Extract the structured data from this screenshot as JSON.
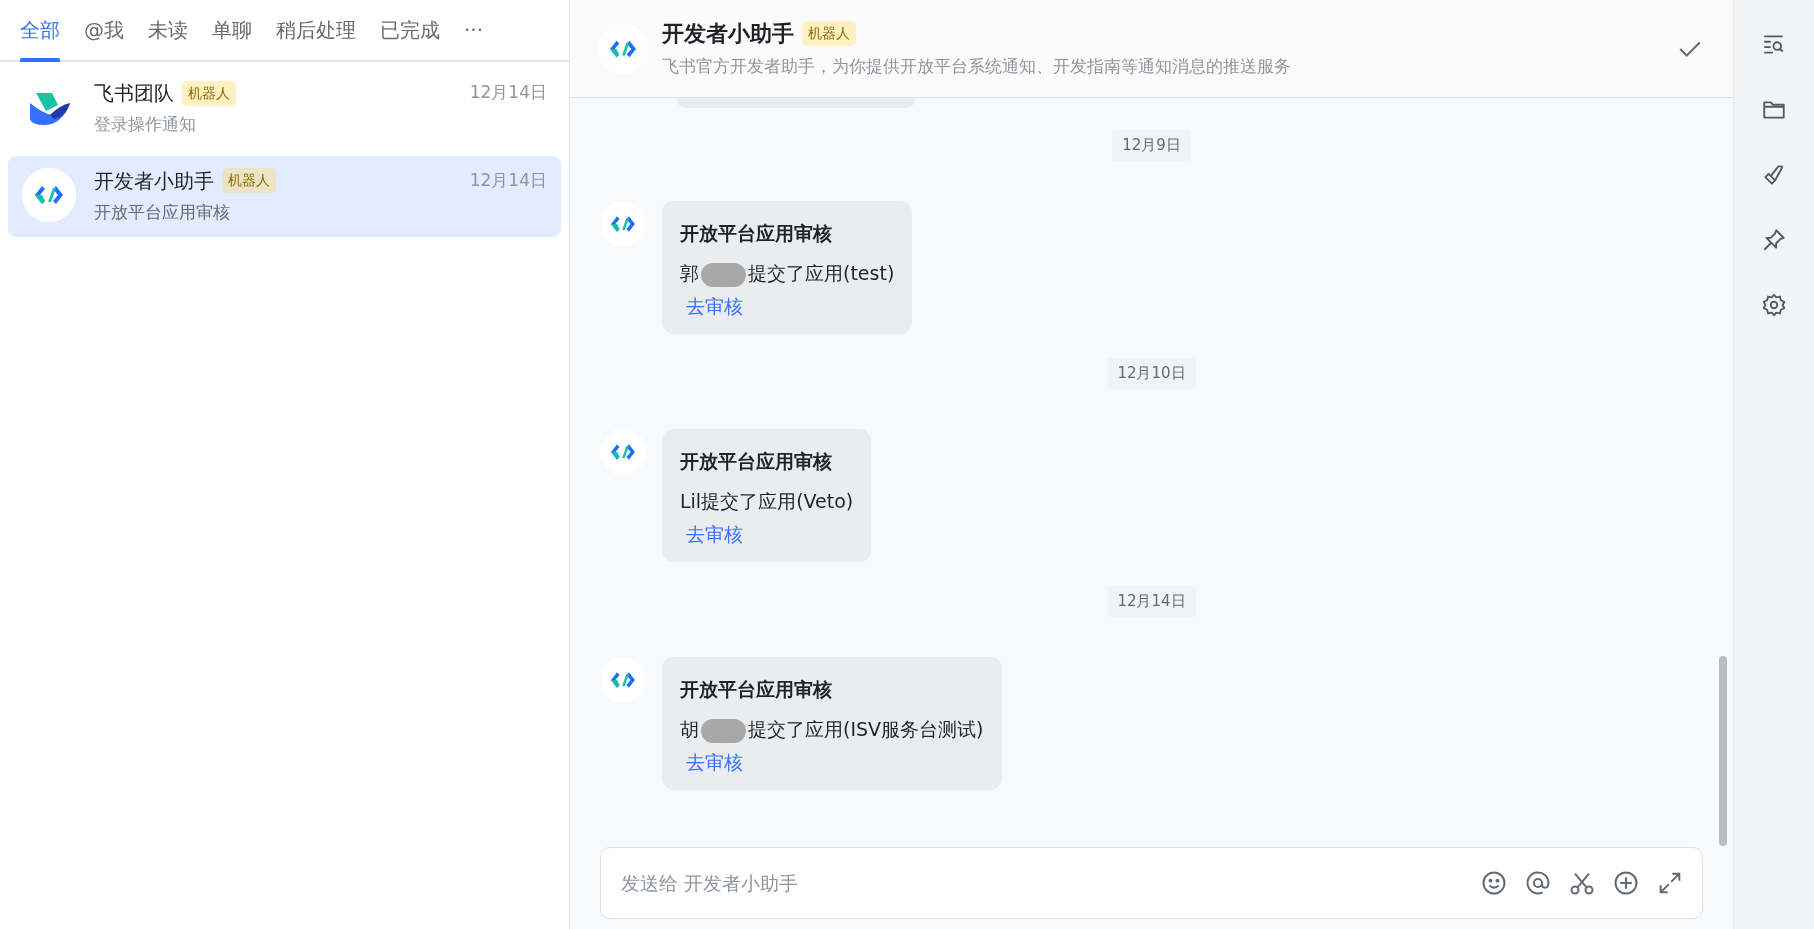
{
  "tabs": [
    {
      "label": "全部",
      "selected": true
    },
    {
      "label": "@我",
      "selected": false
    },
    {
      "label": "未读",
      "selected": false
    },
    {
      "label": "单聊",
      "selected": false
    },
    {
      "label": "稍后处理",
      "selected": false
    },
    {
      "label": "已完成",
      "selected": false
    },
    {
      "label": "···",
      "selected": false
    }
  ],
  "conversations": [
    {
      "name": "飞书团队",
      "badge": "机器人",
      "time": "12月14日",
      "preview": "登录操作通知",
      "kind": "feishu",
      "selected": false
    },
    {
      "name": "开发者小助手",
      "badge": "机器人",
      "time": "12月14日",
      "preview": "开放平台应用审核",
      "kind": "dev",
      "selected": true
    }
  ],
  "chat_header": {
    "title": "开发者小助手",
    "badge": "机器人",
    "subtitle": "飞书官方开发者助手，为你提供开放平台系统通知、开发指南等通知消息的推送服务"
  },
  "timeline": [
    {
      "kind": "cut"
    },
    {
      "kind": "date",
      "text": "12月9日"
    },
    {
      "kind": "message",
      "title": "开放平台应用审核",
      "prefix": "郭",
      "redacted": true,
      "suffix": "提交了应用(test)",
      "link": "去审核"
    },
    {
      "kind": "date",
      "text": "12月10日"
    },
    {
      "kind": "message",
      "title": "开放平台应用审核",
      "prefix": "Lil",
      "redacted": false,
      "suffix": "提交了应用(Veto)",
      "link": "去审核"
    },
    {
      "kind": "date",
      "text": "12月14日"
    },
    {
      "kind": "message",
      "title": "开放平台应用审核",
      "prefix": "胡",
      "redacted": true,
      "suffix": "提交了应用(ISV服务台测试)",
      "link": "去审核"
    }
  ],
  "composer": {
    "placeholder": "发送给 开发者小助手"
  }
}
